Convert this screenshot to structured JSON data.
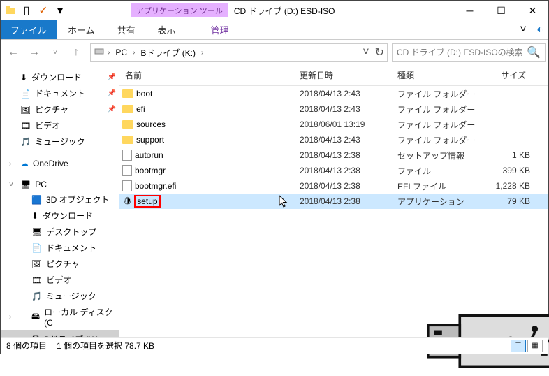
{
  "title": {
    "tools_tab": "アプリケーション ツール",
    "window": "CD ドライブ (D:) ESD-ISO"
  },
  "ribbon": {
    "file": "ファイル",
    "tabs": [
      "ホーム",
      "共有",
      "表示"
    ],
    "tool_tab": "管理"
  },
  "breadcrumbs": [
    "PC",
    "Bドライブ (K:)"
  ],
  "search": {
    "placeholder": "CD ドライブ (D:) ESD-ISOの検索"
  },
  "nav": {
    "quick": [
      {
        "label": "ダウンロード",
        "pin": true
      },
      {
        "label": "ドキュメント",
        "pin": true
      },
      {
        "label": "ピクチャ",
        "pin": true
      },
      {
        "label": "ビデオ",
        "pin": false
      },
      {
        "label": "ミュージック",
        "pin": false
      }
    ],
    "onedrive": "OneDrive",
    "pc": "PC",
    "pc_children": [
      "3D オブジェクト",
      "ダウンロード",
      "デスクトップ",
      "ドキュメント",
      "ピクチャ",
      "ビデオ",
      "ミュージック",
      "ローカル ディスク (C",
      "Bドライブ (K:)"
    ]
  },
  "columns": {
    "name": "名前",
    "date": "更新日時",
    "type": "種類",
    "size": "サイズ"
  },
  "files": [
    {
      "name": "boot",
      "date": "2018/04/13 2:43",
      "type": "ファイル フォルダー",
      "size": "",
      "icon": "folder"
    },
    {
      "name": "efi",
      "date": "2018/04/13 2:43",
      "type": "ファイル フォルダー",
      "size": "",
      "icon": "folder"
    },
    {
      "name": "sources",
      "date": "2018/06/01 13:19",
      "type": "ファイル フォルダー",
      "size": "",
      "icon": "folder"
    },
    {
      "name": "support",
      "date": "2018/04/13 2:43",
      "type": "ファイル フォルダー",
      "size": "",
      "icon": "folder"
    },
    {
      "name": "autorun",
      "date": "2018/04/13 2:38",
      "type": "セットアップ情報",
      "size": "1 KB",
      "icon": "file"
    },
    {
      "name": "bootmgr",
      "date": "2018/04/13 2:38",
      "type": "ファイル",
      "size": "399 KB",
      "icon": "file"
    },
    {
      "name": "bootmgr.efi",
      "date": "2018/04/13 2:38",
      "type": "EFI ファイル",
      "size": "1,228 KB",
      "icon": "file"
    },
    {
      "name": "setup",
      "date": "2018/04/13 2:38",
      "type": "アプリケーション",
      "size": "79 KB",
      "icon": "app",
      "selected": true
    }
  ],
  "status": {
    "count": "8 個の項目",
    "selected": "1 個の項目を選択 78.7 KB"
  }
}
